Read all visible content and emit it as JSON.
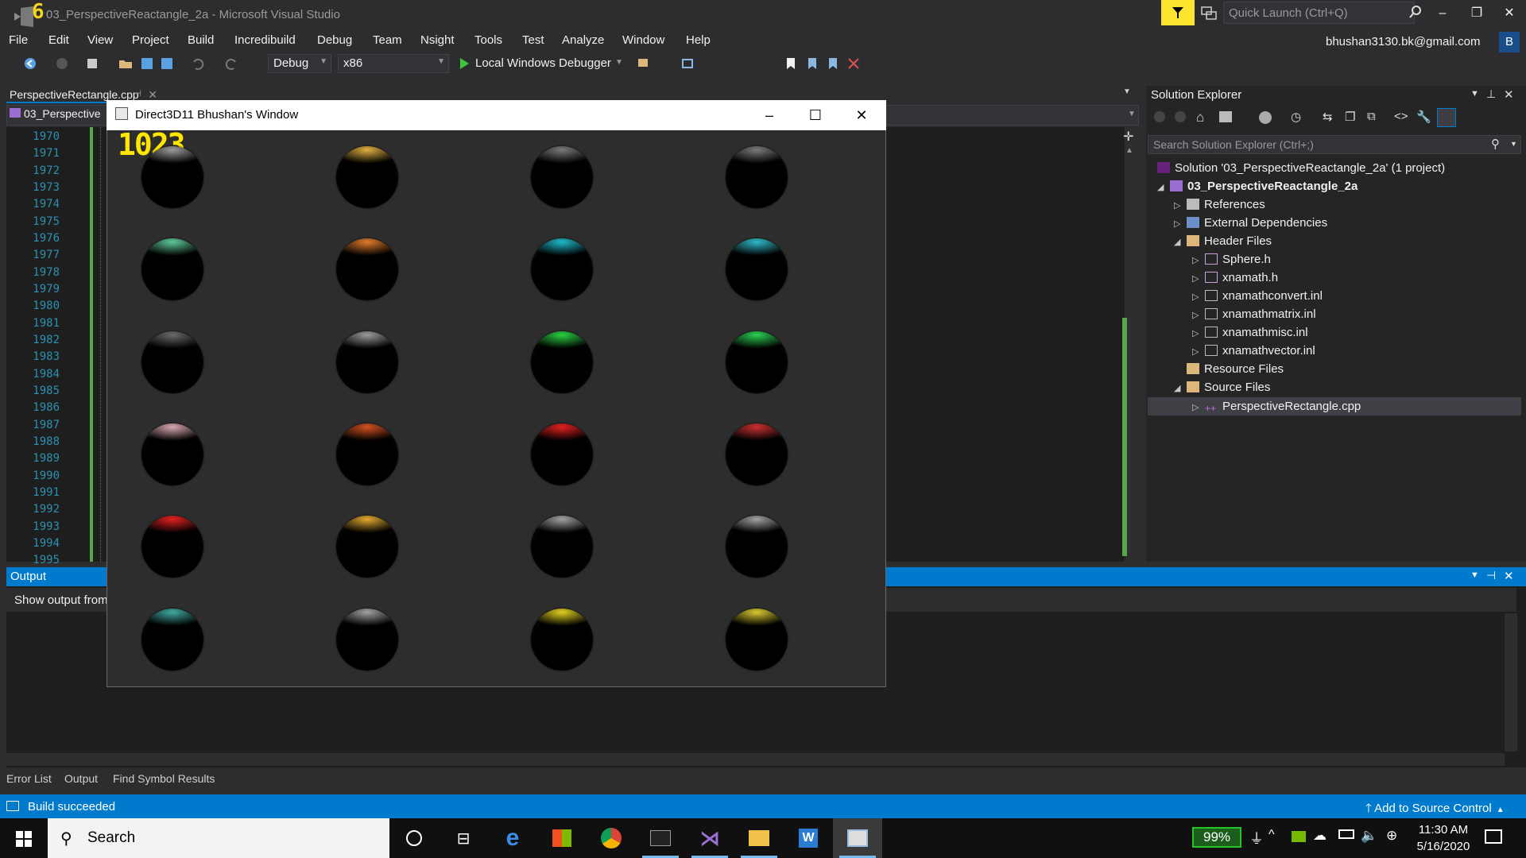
{
  "window": {
    "title": "03_PerspectiveReactangle_2a - Microsoft Visual Studio",
    "quick_launch_placeholder": "Quick Launch (Ctrl+Q)",
    "badge_digit": "6",
    "account_email": "bhushan3130.bk@gmail.com",
    "account_initial": "B"
  },
  "menu": [
    "File",
    "Edit",
    "View",
    "Project",
    "Build",
    "Incredibuild",
    "Debug",
    "Team",
    "Nsight",
    "Tools",
    "Test",
    "Analyze",
    "Window",
    "Help"
  ],
  "toolbar": {
    "configuration": "Debug",
    "platform": "x86",
    "debugger": "Local Windows Debugger"
  },
  "editor": {
    "tab_label": "PerspectiveRectangle.cpp",
    "nav_project": "03_Perspective",
    "line_numbers": [
      "1970",
      "1971",
      "1972",
      "1973",
      "1974",
      "1975",
      "1976",
      "1977",
      "1978",
      "1979",
      "1980",
      "1981",
      "1982",
      "1983",
      "1984",
      "1985",
      "1986",
      "1987",
      "1988",
      "1989",
      "1990",
      "1991",
      "1992",
      "1993",
      "1994",
      "1995"
    ]
  },
  "solution_explorer": {
    "title": "Solution Explorer",
    "search_placeholder": "Search Solution Explorer (Ctrl+;)",
    "solution": "Solution '03_PerspectiveReactangle_2a' (1 project)",
    "project": "03_PerspectiveReactangle_2a",
    "nodes": [
      "References",
      "External Dependencies",
      "Header Files"
    ],
    "header_files": [
      "Sphere.h",
      "xnamath.h",
      "xnamathconvert.inl",
      "xnamathmatrix.inl",
      "xnamathmisc.inl",
      "xnamathvector.inl"
    ],
    "resource_files": "Resource Files",
    "source_files": "Source Files",
    "source_items": [
      "PerspectiveRectangle.cpp"
    ]
  },
  "output": {
    "title": "Output",
    "show_output_label": "Show output from"
  },
  "bottom_tabs": [
    "Error List",
    "Output",
    "Find Symbol Results"
  ],
  "status": {
    "message": "Build succeeded",
    "source_control": "Add to Source Control"
  },
  "d3d_window": {
    "title": "Direct3D11 Bhushan's Window",
    "fps": "1023",
    "sphere_highlights": [
      "#9c9c9c",
      "#e0b040",
      "#7a7a7a",
      "#7a7a7a",
      "#5fc898",
      "#e07a2a",
      "#1fb8c8",
      "#2fb8c8",
      "#6a6a6a",
      "#9a9a9a",
      "#2ad040",
      "#2ad050",
      "#d8a8b0",
      "#d05020",
      "#e02020",
      "#c83030",
      "#e02020",
      "#e0a830",
      "#a0a0a0",
      "#a0a0a0",
      "#40a8a0",
      "#a0a0a0",
      "#e0d020",
      "#d8c830"
    ]
  },
  "taskbar": {
    "search_label": "Search",
    "battery": "99%",
    "time": "11:30 AM",
    "date": "5/16/2020"
  }
}
